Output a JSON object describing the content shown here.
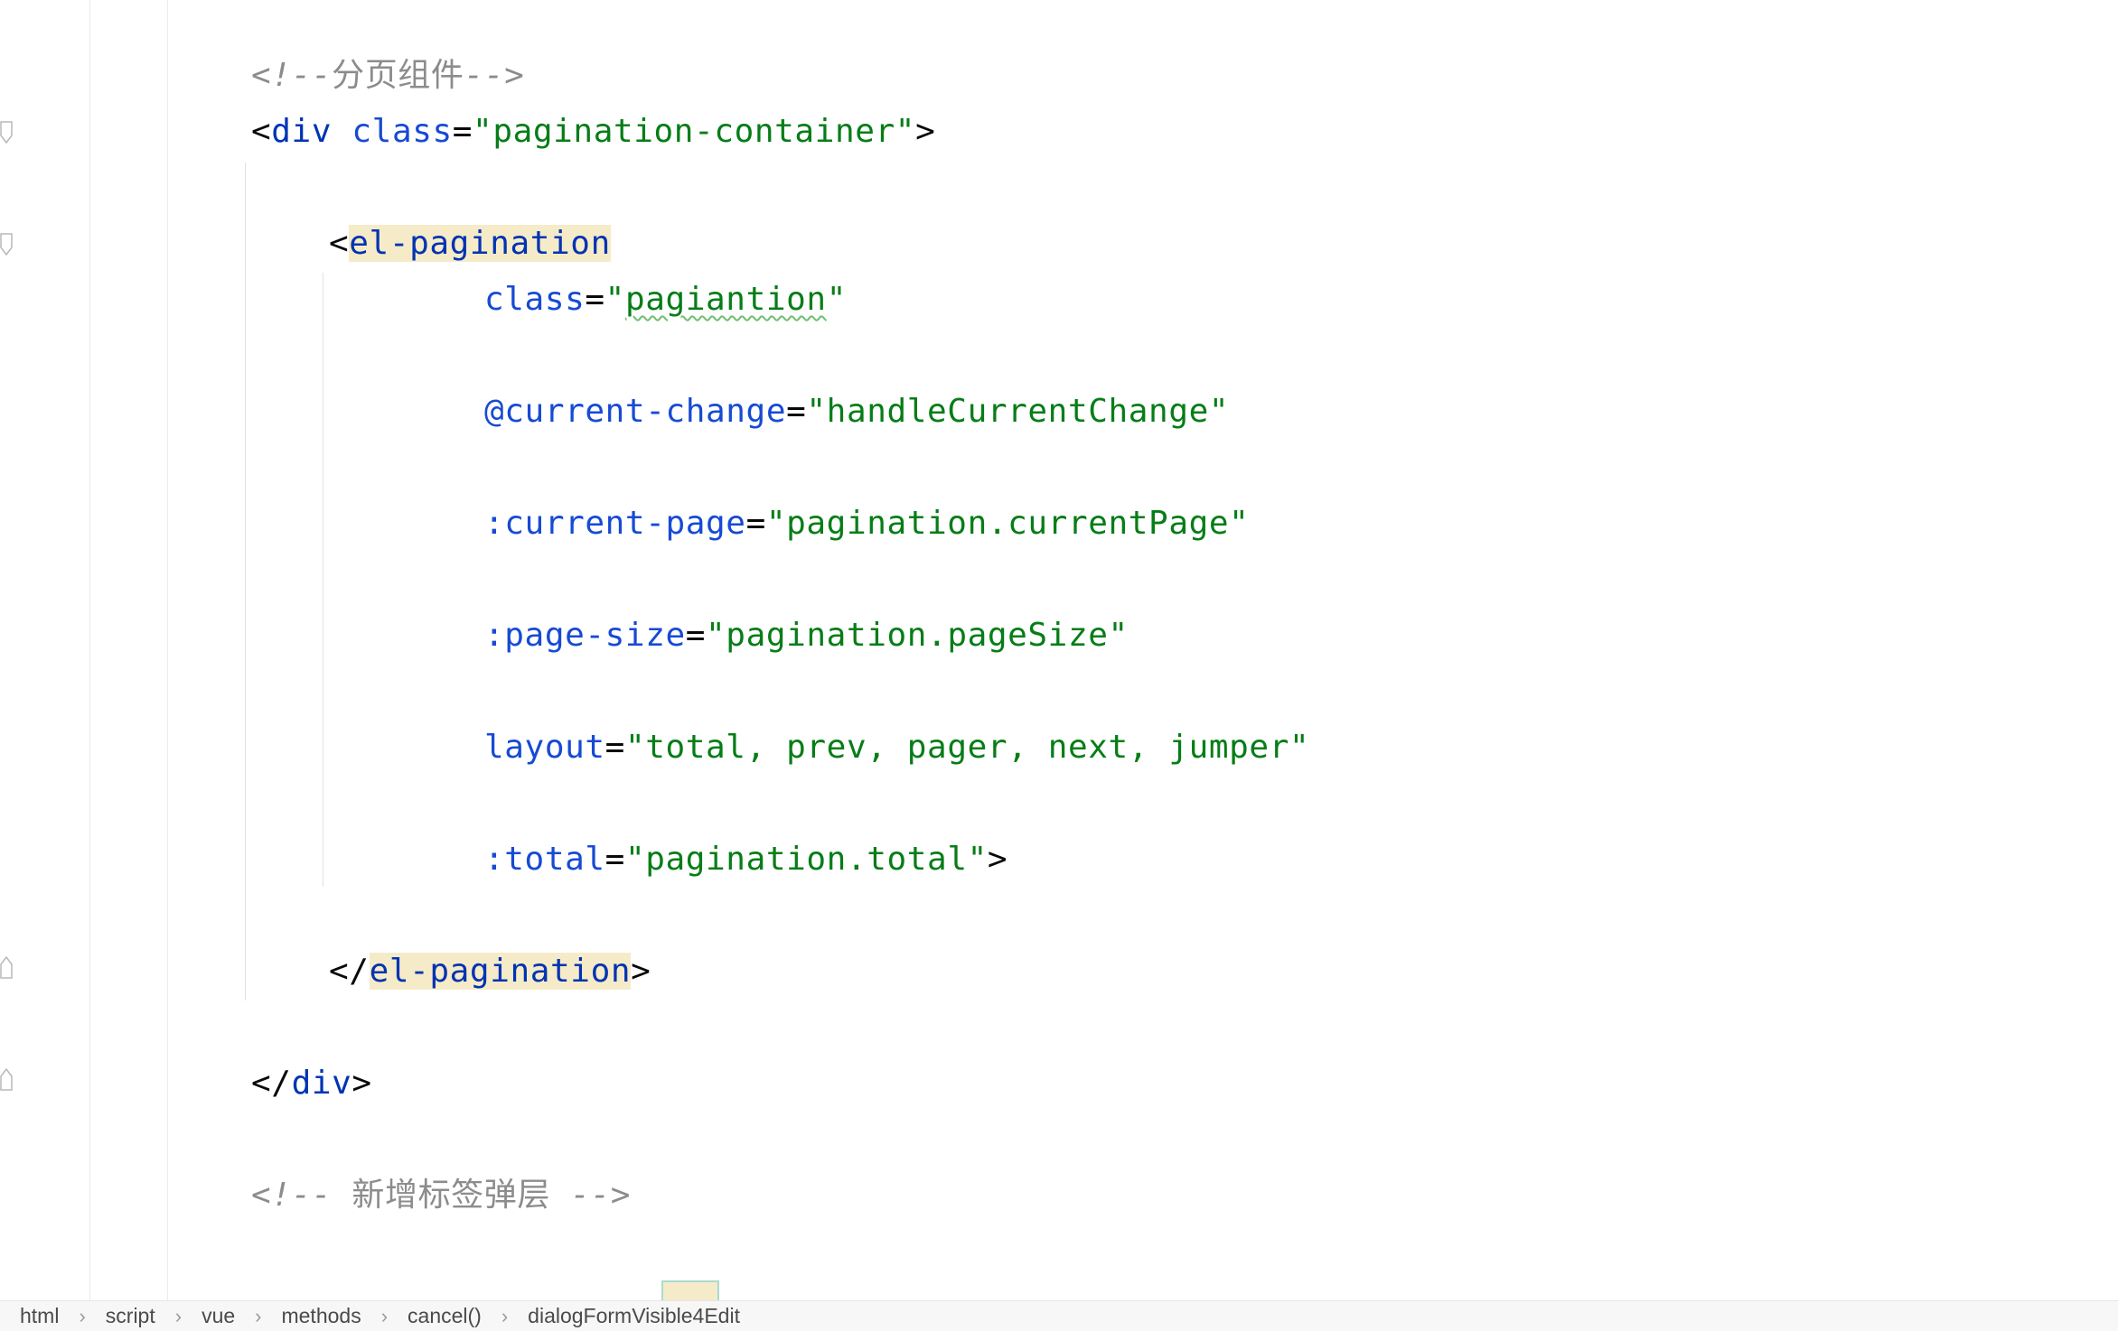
{
  "editor": {
    "lines": [
      {
        "id": "comment-pagination",
        "parts": [
          [
            "comment",
            "<!--"
          ],
          [
            "comment-cjk",
            "分页组件"
          ],
          [
            "comment",
            "-->"
          ]
        ]
      },
      {
        "id": "div-open",
        "parts": [
          [
            "punct",
            "<"
          ],
          [
            "tag",
            "div"
          ],
          [
            "punct",
            " "
          ],
          [
            "attr",
            "class"
          ],
          [
            "punct",
            "="
          ],
          [
            "val",
            "\"pagination-container\""
          ],
          [
            "punct",
            ">"
          ]
        ]
      },
      {
        "id": "el-pagination-open",
        "parts": [
          [
            "punct",
            "<"
          ],
          [
            "tag hl",
            "el-pagination"
          ]
        ]
      },
      {
        "id": "attr-class",
        "parts": [
          [
            "attr",
            "class"
          ],
          [
            "punct",
            "="
          ],
          [
            "val",
            "\""
          ],
          [
            "val typo",
            "pagiantion"
          ],
          [
            "val",
            "\""
          ]
        ]
      },
      {
        "id": "attr-current-change",
        "parts": [
          [
            "attr",
            "@current-change"
          ],
          [
            "punct",
            "="
          ],
          [
            "val",
            "\"handleCurrentChange\""
          ]
        ]
      },
      {
        "id": "attr-current-page",
        "parts": [
          [
            "attr",
            ":current-page"
          ],
          [
            "punct",
            "="
          ],
          [
            "val",
            "\"pagination.currentPage\""
          ]
        ]
      },
      {
        "id": "attr-page-size",
        "parts": [
          [
            "attr",
            ":page-size"
          ],
          [
            "punct",
            "="
          ],
          [
            "val",
            "\"pagination.pageSize\""
          ]
        ]
      },
      {
        "id": "attr-layout",
        "parts": [
          [
            "attr",
            "layout"
          ],
          [
            "punct",
            "="
          ],
          [
            "val",
            "\"total, prev, pager, next, jumper\""
          ]
        ]
      },
      {
        "id": "attr-total",
        "parts": [
          [
            "attr",
            ":total"
          ],
          [
            "punct",
            "="
          ],
          [
            "val",
            "\"pagination.total\""
          ],
          [
            "punct",
            ">"
          ]
        ]
      },
      {
        "id": "el-pagination-close",
        "parts": [
          [
            "punct",
            "</"
          ],
          [
            "tag hl",
            "el-pagination"
          ],
          [
            "punct",
            ">"
          ]
        ]
      },
      {
        "id": "div-close",
        "parts": [
          [
            "punct",
            "</"
          ],
          [
            "tag",
            "div"
          ],
          [
            "punct",
            ">"
          ]
        ]
      },
      {
        "id": "comment-new-tag",
        "parts": [
          [
            "comment",
            "<!-- "
          ],
          [
            "comment-cjk",
            "新增标签弹层"
          ],
          [
            "comment",
            " -->"
          ]
        ]
      }
    ]
  },
  "breadcrumb": {
    "items": [
      "html",
      "script",
      "vue",
      "methods",
      "cancel()",
      "dialogFormVisible4Edit"
    ],
    "separator": "›"
  }
}
